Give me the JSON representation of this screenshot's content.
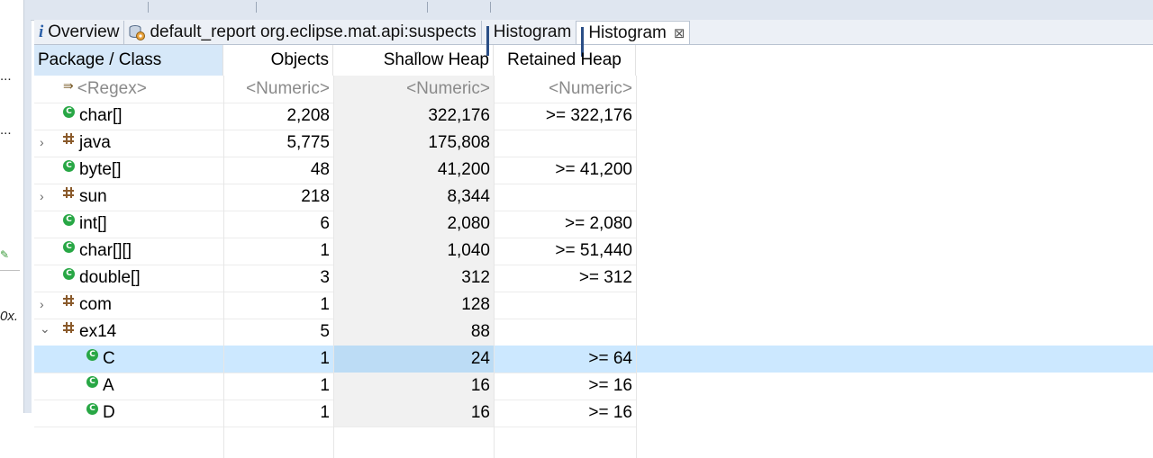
{
  "left_panel": {
    "fragments": [
      "...",
      "...",
      "0x."
    ]
  },
  "tabs": [
    {
      "label": "Overview",
      "icon": "info-icon",
      "active": false
    },
    {
      "label": "default_report  org.eclipse.mat.api:suspects",
      "icon": "report-icon",
      "active": false
    },
    {
      "label": "Histogram",
      "icon": "histogram-icon",
      "active": false
    },
    {
      "label": "Histogram",
      "icon": "histogram-icon",
      "active": true,
      "close": "⊠"
    }
  ],
  "table": {
    "columns": [
      "Package / Class",
      "Objects",
      "Shallow Heap",
      "Retained Heap"
    ],
    "filter_row": {
      "class": "<Regex>",
      "objects": "<Numeric>",
      "shallow": "<Numeric>",
      "retained": "<Numeric>"
    },
    "rows": [
      {
        "name": "char[]",
        "kind": "class",
        "objects": "2,208",
        "shallow": "322,176",
        "retained": ">= 322,176",
        "expander": ""
      },
      {
        "name": "java",
        "kind": "package",
        "objects": "5,775",
        "shallow": "175,808",
        "retained": "",
        "expander": "›"
      },
      {
        "name": "byte[]",
        "kind": "class",
        "objects": "48",
        "shallow": "41,200",
        "retained": ">= 41,200",
        "expander": ""
      },
      {
        "name": "sun",
        "kind": "package",
        "objects": "218",
        "shallow": "8,344",
        "retained": "",
        "expander": "›"
      },
      {
        "name": "int[]",
        "kind": "class",
        "objects": "6",
        "shallow": "2,080",
        "retained": ">= 2,080",
        "expander": ""
      },
      {
        "name": "char[][]",
        "kind": "class",
        "objects": "1",
        "shallow": "1,040",
        "retained": ">= 51,440",
        "expander": ""
      },
      {
        "name": "double[]",
        "kind": "class",
        "objects": "3",
        "shallow": "312",
        "retained": ">= 312",
        "expander": ""
      },
      {
        "name": "com",
        "kind": "package",
        "objects": "1",
        "shallow": "128",
        "retained": "",
        "expander": "›"
      },
      {
        "name": "ex14",
        "kind": "package",
        "objects": "5",
        "shallow": "88",
        "retained": "",
        "expander": "⌄"
      },
      {
        "name": "C",
        "kind": "class",
        "objects": "1",
        "shallow": "24",
        "retained": ">= 64",
        "expander": "",
        "indent": true,
        "selected": true
      },
      {
        "name": "A",
        "kind": "class",
        "objects": "1",
        "shallow": "16",
        "retained": ">= 16",
        "expander": "",
        "indent": true
      },
      {
        "name": "D",
        "kind": "class",
        "objects": "1",
        "shallow": "16",
        "retained": ">= 16",
        "expander": "",
        "indent": true
      }
    ]
  },
  "icons": {
    "class": "class-icon",
    "class_glyph": "C",
    "package": "package-icon",
    "regex": "regex-filter-icon",
    "regex_glyph": "⇛"
  },
  "colors": {
    "selection": "#cce8ff",
    "class_icon": "#28a745",
    "tab_bar": "#ecf0f6"
  }
}
